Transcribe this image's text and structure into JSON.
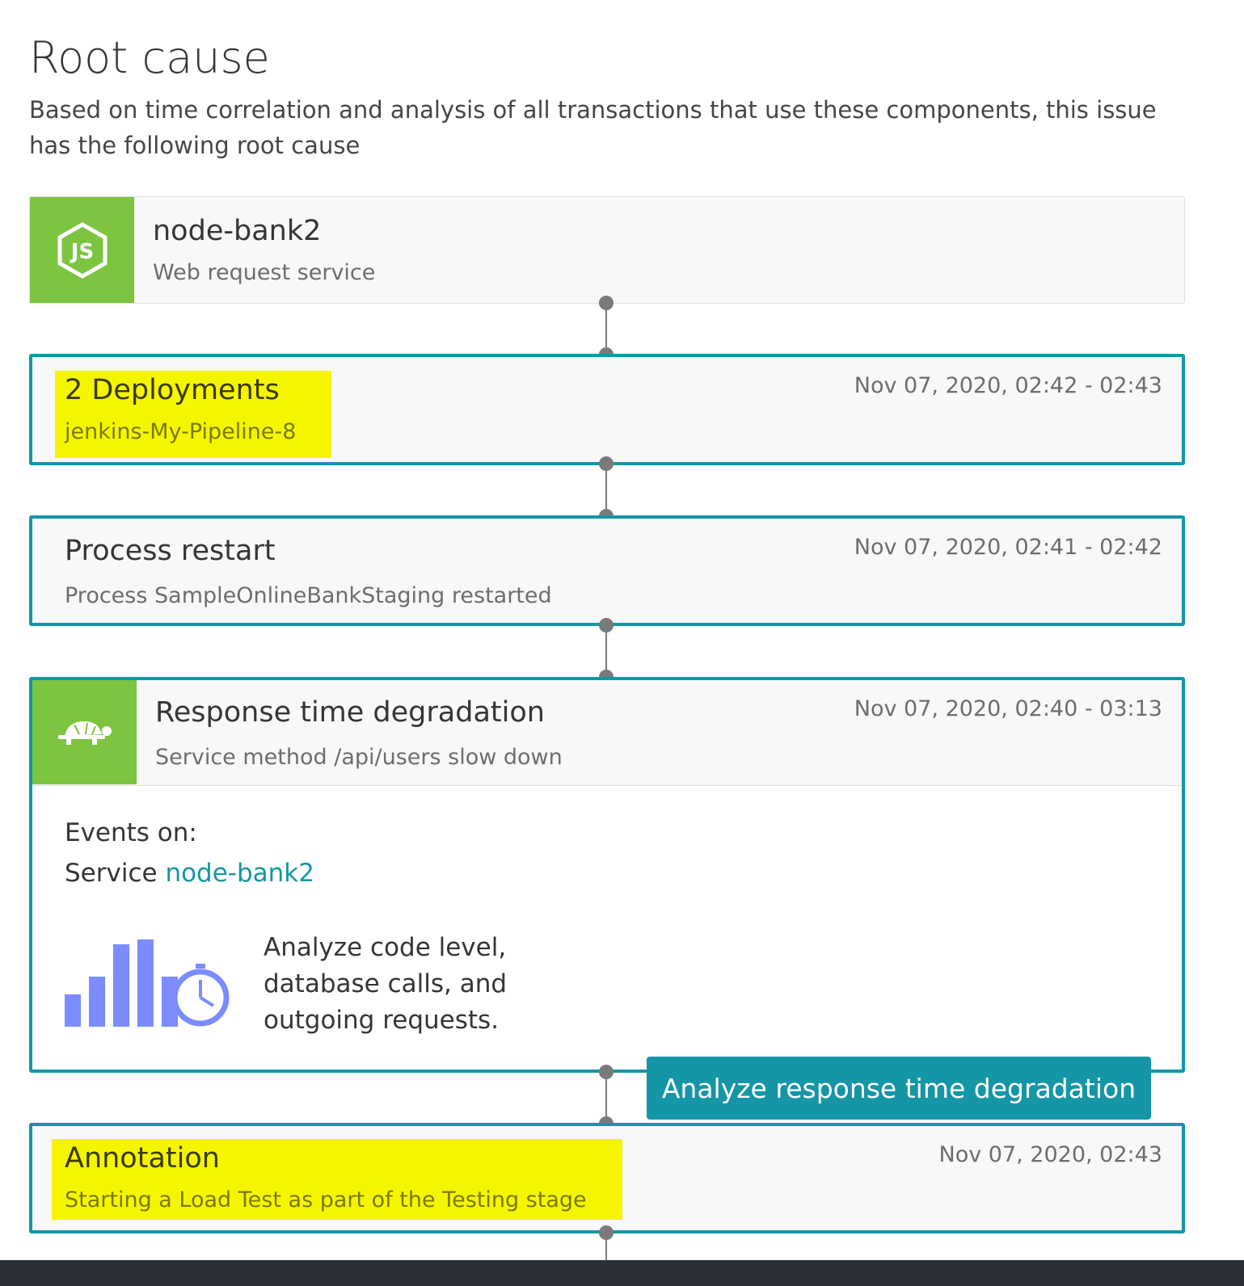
{
  "header": {
    "title": "Root cause",
    "description": "Based on time correlation and analysis of all transactions that use these components, this issue has the following root cause"
  },
  "service_card": {
    "icon": "nodejs-icon",
    "name": "node-bank2",
    "type": "Web request service"
  },
  "deployments": {
    "title": "2 Deployments",
    "subtitle": "jenkins-My-Pipeline-8",
    "time": "Nov 07, 2020, 02:42 - 02:43"
  },
  "process_restart": {
    "title": "Process restart",
    "subtitle": "Process SampleOnlineBankStaging restarted",
    "time": "Nov 07, 2020, 02:41 - 02:42"
  },
  "response_time": {
    "icon": "turtle-icon",
    "title": "Response time degradation",
    "subtitle": "Service method /api/users slow down",
    "time": "Nov 07, 2020, 02:40 - 03:13",
    "events_label": "Events on:",
    "service_prefix": "Service",
    "service_link": "node-bank2",
    "analyze_text": "Analyze code level, database calls, and outgoing requests.",
    "button_label": "Analyze response time degradation"
  },
  "annotation": {
    "title": "Annotation",
    "subtitle": "Starting a Load Test as part of the Testing stage",
    "time": "Nov 07, 2020, 02:43"
  },
  "colors": {
    "accent": "#1496a7",
    "icon_bg": "#7dc540",
    "highlight": "#f5f500",
    "chart_icon": "#7b8cff"
  }
}
